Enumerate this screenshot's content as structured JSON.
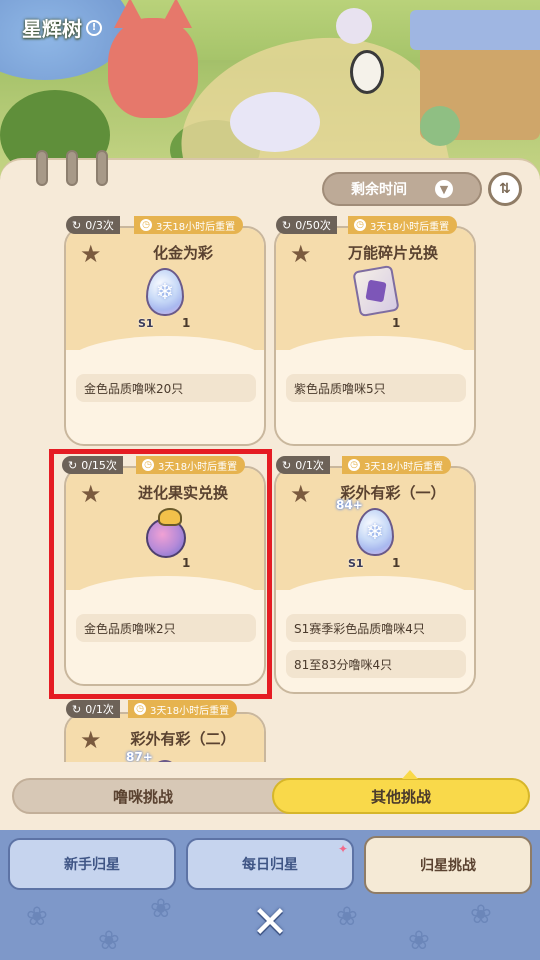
{
  "header": {
    "title": "星辉树",
    "help_icon": "help-icon"
  },
  "filter": {
    "label": "剩余时间",
    "icon": "chevron-down-icon",
    "sort_icon": "sort-icon"
  },
  "cards": [
    {
      "count": "0/3次",
      "reset": "3天18小时后重置",
      "title": "化金为彩",
      "item": "egg",
      "item_badge": "S1",
      "qty": "1",
      "reqs": [
        "金色品质噜咪20只"
      ]
    },
    {
      "count": "0/50次",
      "reset": "3天18小时后重置",
      "title": "万能碎片兑换",
      "item": "shard",
      "qty": "1",
      "reqs": [
        "紫色品质噜咪5只"
      ]
    },
    {
      "count": "0/15次",
      "reset": "3天18小时后重置",
      "title": "进化果实兑换",
      "item": "fruit",
      "qty": "1",
      "reqs": [
        "金色品质噜咪2只"
      ]
    },
    {
      "count": "0/1次",
      "reset": "3天18小时后重置",
      "title": "彩外有彩（一）",
      "item": "egg",
      "item_badge": "S1",
      "level": "84+",
      "qty": "1",
      "reqs": [
        "S1赛季彩色品质噜咪4只",
        "81至83分噜咪4只"
      ]
    },
    {
      "count": "0/1次",
      "reset": "3天18小时后重置",
      "title": "彩外有彩（二）",
      "level": "87+"
    }
  ],
  "segmented": {
    "left": "噜咪挑战",
    "right": "其他挑战",
    "selected": "right"
  },
  "tabs": [
    {
      "label": "新手归星",
      "state": "inactive"
    },
    {
      "label": "每日归星",
      "state": "inactive",
      "badge": "✦"
    },
    {
      "label": "归星挑战",
      "state": "active"
    }
  ],
  "close_icon": "close-icon",
  "colors": {
    "highlight": "#e51c23",
    "accent_yellow": "#f9d94a",
    "panel": "#f6ead8"
  }
}
